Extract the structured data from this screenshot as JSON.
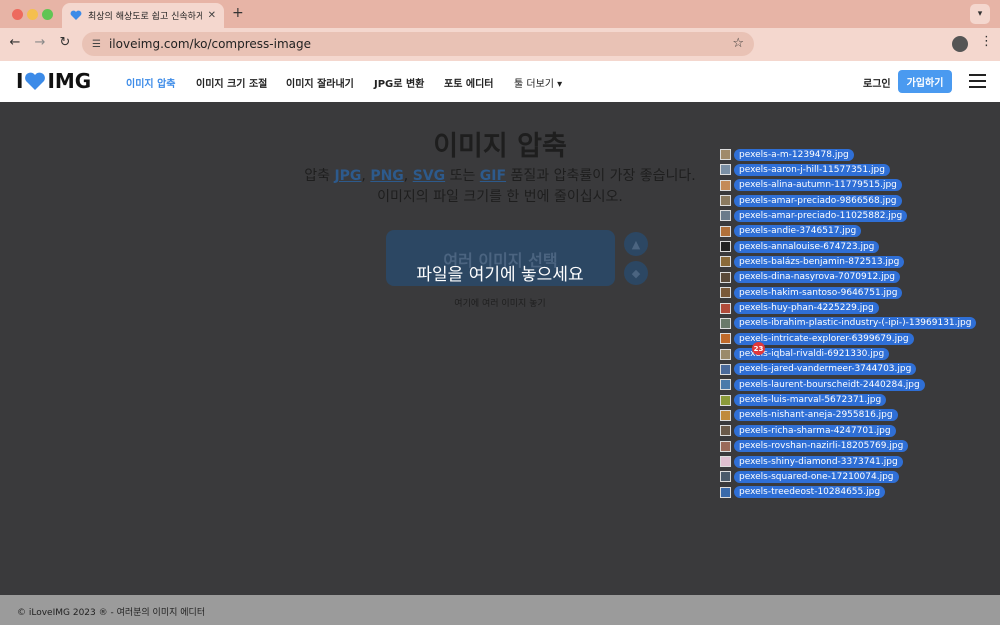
{
  "browser": {
    "tab_title": "최상의 해상도로 쉽고 신속하게 이미",
    "tab_close": "✕",
    "new_tab": "+",
    "url": "iloveimg.com/ko/compress-image"
  },
  "site": {
    "logo_left": "I",
    "logo_right": "IMG",
    "nav": [
      "이미지 압축",
      "이미지 크기 조절",
      "이미지 잘라내기",
      "JPG로 변환",
      "포토 에디터",
      "툴 더보기"
    ],
    "login": "로그인",
    "signup": "가입하기"
  },
  "main": {
    "title": "이미지 압축",
    "subtitle_prefix": "압축",
    "format_jpg": "JPG",
    "sep1": ", ",
    "format_png": "PNG",
    "sep2": ", ",
    "format_svg": "SVG",
    "or_text": " 또는 ",
    "format_gif": "GIF",
    "subtitle_suffix": " 품질과 압축률이 가장 좋습니다.",
    "subtitle_line2": "이미지의 파일 크기를 한 번에 줄이십시오.",
    "select_button": "여러 이미지 선택",
    "drop_hint": "여기에 여러 이미지 놓기",
    "drop_overlay": "파일을 여기에 놓으세요"
  },
  "drag": {
    "count": "23",
    "files": [
      {
        "name": "pexels-a-m-1239478.jpg",
        "color": "#a08a6a"
      },
      {
        "name": "pexels-aaron-j-hill-11577351.jpg",
        "color": "#7a8fa4"
      },
      {
        "name": "pexels-alina-autumn-11779515.jpg",
        "color": "#c48a58"
      },
      {
        "name": "pexels-amar-preciado-9866568.jpg",
        "color": "#8a7a60"
      },
      {
        "name": "pexels-amar-preciado-11025882.jpg",
        "color": "#6a7a8a"
      },
      {
        "name": "pexels-andie-3746517.jpg",
        "color": "#b0703a"
      },
      {
        "name": "pexels-annalouise-674723.jpg",
        "color": "#222222"
      },
      {
        "name": "pexels-balázs-benjamin-872513.jpg",
        "color": "#8a6a3a"
      },
      {
        "name": "pexels-dina-nasyrova-7070912.jpg",
        "color": "#5a4a3a"
      },
      {
        "name": "pexels-hakim-santoso-9646751.jpg",
        "color": "#7a5a3a"
      },
      {
        "name": "pexels-huy-phan-4225229.jpg",
        "color": "#b04a3a"
      },
      {
        "name": "pexels-ibrahim-plastic-industry-(-ipi-)-13969131.jpg",
        "color": "#6a7a6a"
      },
      {
        "name": "pexels-intricate-explorer-6399679.jpg",
        "color": "#c06a2a"
      },
      {
        "name": "pexels-iqbal-rivaldi-6921330.jpg",
        "color": "#9a8a6a"
      },
      {
        "name": "pexels-jared-vandermeer-3744703.jpg",
        "color": "#4a6a9a"
      },
      {
        "name": "pexels-laurent-bourscheidt-2440284.jpg",
        "color": "#4a7aaa"
      },
      {
        "name": "pexels-luis-marval-5672371.jpg",
        "color": "#8a9a3a"
      },
      {
        "name": "pexels-nishant-aneja-2955816.jpg",
        "color": "#c08a3a"
      },
      {
        "name": "pexels-richa-sharma-4247701.jpg",
        "color": "#6a5a4a"
      },
      {
        "name": "pexels-rovshan-nazirli-18205769.jpg",
        "color": "#9a6a5a"
      },
      {
        "name": "pexels-shiny-diamond-3373741.jpg",
        "color": "#e0c0d0"
      },
      {
        "name": "pexels-squared-one-17210074.jpg",
        "color": "#4a5a6a"
      },
      {
        "name": "pexels-treedeost-10284655.jpg",
        "color": "#3a6aaa"
      }
    ]
  },
  "footer": {
    "text": "© iLoveIMG 2023 ® - 여러분의 이미지 에디터"
  },
  "colors": {
    "accent": "#3c8be8",
    "file_highlight": "#2f6fd6",
    "badge": "#e0383b"
  }
}
